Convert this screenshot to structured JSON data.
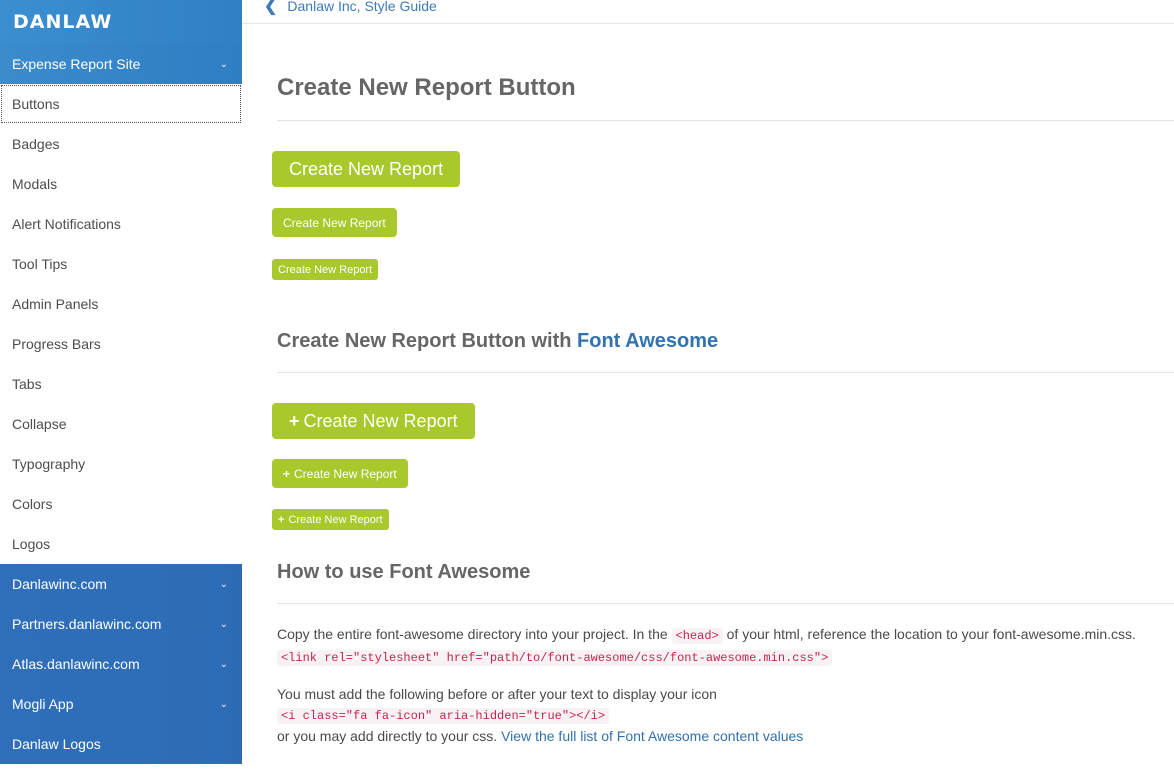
{
  "brand": "DANLAW",
  "sidebar": {
    "sections": [
      {
        "label": "Expense Report Site",
        "expanded": true,
        "items": [
          "Buttons",
          "Badges",
          "Modals",
          "Alert Notifications",
          "Tool Tips",
          "Admin Panels",
          "Progress Bars",
          "Tabs",
          "Collapse",
          "Typography",
          "Colors",
          "Logos"
        ]
      },
      {
        "label": "Danlawinc.com"
      },
      {
        "label": "Partners.danlawinc.com"
      },
      {
        "label": "Atlas.danlawinc.com"
      },
      {
        "label": "Mogli App"
      },
      {
        "label": "Danlaw Logos"
      }
    ]
  },
  "breadcrumb": "Danlaw Inc, Style Guide",
  "main": {
    "heading": "Create New Report Button",
    "button_label": "Create New Report",
    "plus_glyph": "+",
    "fa_heading_prefix": "Create New Report Button with ",
    "fa_heading_link": "Font Awesome",
    "howto_heading": "How to use Font Awesome",
    "p1_text_a": "Copy the entire font-awesome directory into your project. In the ",
    "p1_code_head": "<head>",
    "p1_text_b": " of your html, reference the location to your font-awesome.min.css.",
    "p1_code_link": "<link rel=\"stylesheet\" href=\"path/to/font-awesome/css/font-awesome.min.css\">",
    "p2_text": "You must add the following before or after your text to display your icon",
    "p2_code": "<i class=\"fa fa-icon\" aria-hidden=\"true\"></i>",
    "p2_text_b": "or you may add directly to your css. ",
    "p2_link": "View the full list of Font Awesome content values"
  },
  "colors": {
    "button": "#a8c82b",
    "sidebar_blue": "#2f6fba",
    "link": "#3172af"
  }
}
